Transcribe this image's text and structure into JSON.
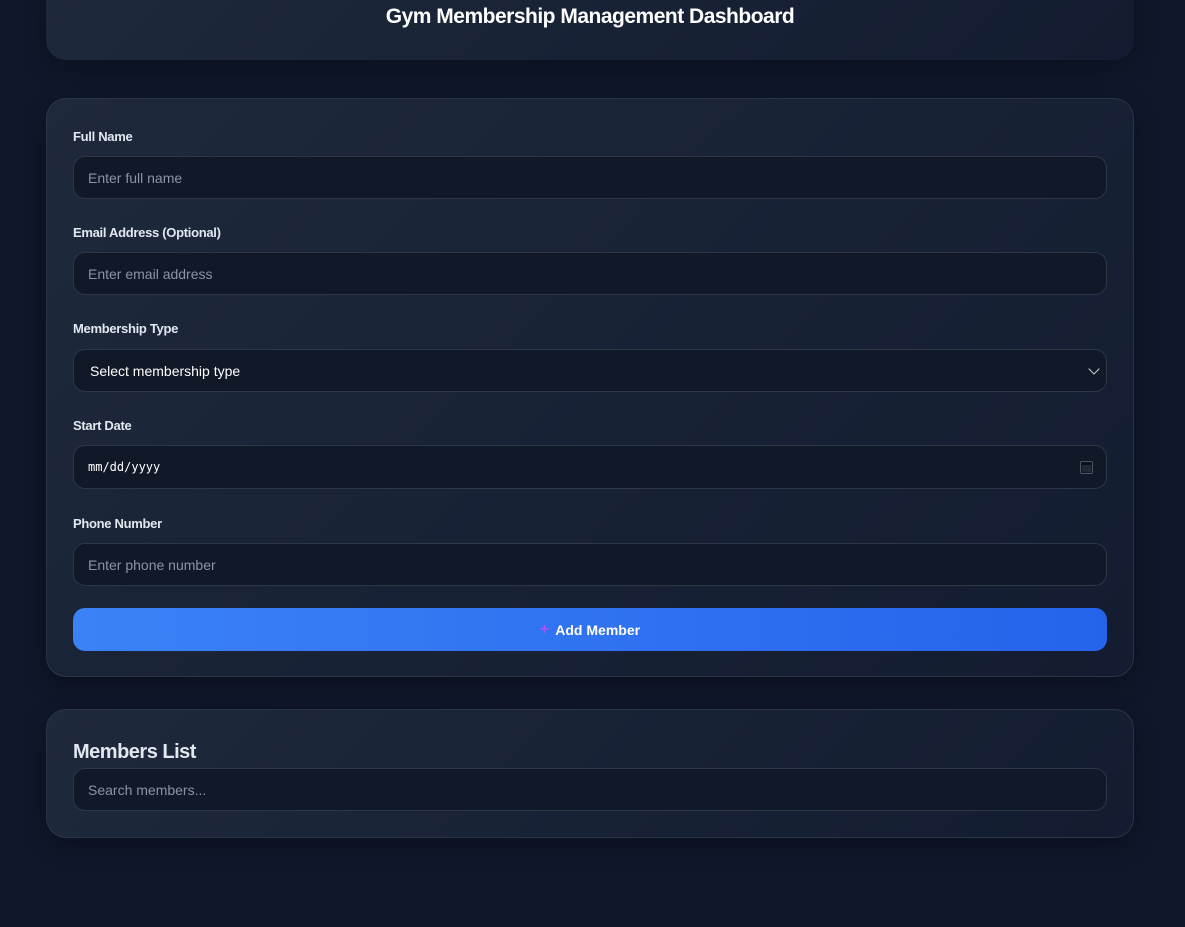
{
  "header": {
    "title": "Gym Membership Management Dashboard"
  },
  "form": {
    "full_name": {
      "label": "Full Name",
      "placeholder": "Enter full name",
      "value": ""
    },
    "email": {
      "label": "Email Address (Optional)",
      "placeholder": "Enter email address",
      "value": ""
    },
    "membership_type": {
      "label": "Membership Type",
      "selected": "Select membership type",
      "icon": "chevron-down-icon"
    },
    "start_date": {
      "label": "Start Date",
      "value": "mm/dd/yyyy",
      "icon": "calendar-icon"
    },
    "phone": {
      "label": "Phone Number",
      "placeholder": "Enter phone number",
      "value": ""
    },
    "submit": {
      "label": "Add Member",
      "icon": "plus-icon",
      "icon_glyph": "+"
    }
  },
  "members_list": {
    "title": "Members List",
    "search": {
      "placeholder": "Search members...",
      "value": ""
    }
  },
  "colors": {
    "background": "#0f172a",
    "card": "#1e293b",
    "input": "#111827",
    "accent": "#3b82f6",
    "plus_icon": "#a855f7"
  }
}
